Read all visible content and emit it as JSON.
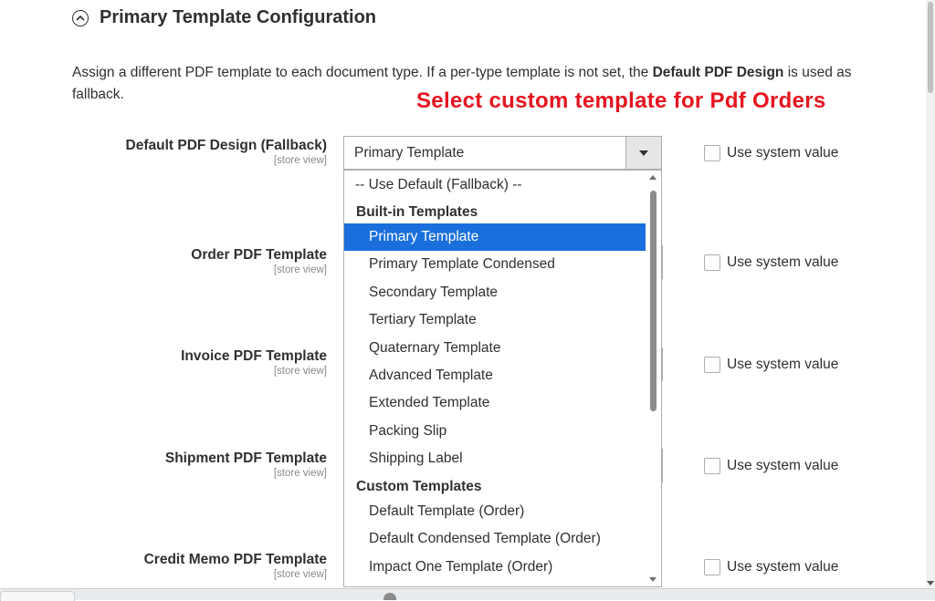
{
  "section": {
    "title": "Primary Template Configuration"
  },
  "description": {
    "part1": "Assign a different PDF template to each document type. If a per-type template is not set, the ",
    "bold": "Default PDF Design",
    "part2": " is used as fallback."
  },
  "annotation": "Select custom template for Pdf Orders",
  "fields": [
    {
      "label": "Default PDF Design (Fallback)",
      "scope": "[store view]",
      "value": "Primary Template",
      "system_value_label": "Use system value"
    },
    {
      "label": "Order PDF Template",
      "scope": "[store view]",
      "system_value_label": "Use system value"
    },
    {
      "label": "Invoice PDF Template",
      "scope": "[store view]",
      "system_value_label": "Use system value"
    },
    {
      "label": "Shipment PDF Template",
      "scope": "[store view]",
      "system_value_label": "Use system value"
    },
    {
      "label": "Credit Memo PDF Template",
      "scope": "[store view]",
      "system_value_label": "Use system value"
    }
  ],
  "dropdown": {
    "default_option": "-- Use Default (Fallback) --",
    "groups": [
      {
        "label": "Built-in Templates",
        "options": [
          "Primary Template",
          "Primary Template Condensed",
          "Secondary Template",
          "Tertiary Template",
          "Quaternary Template",
          "Advanced Template",
          "Extended Template",
          "Packing Slip",
          "Shipping Label"
        ]
      },
      {
        "label": "Custom Templates",
        "options": [
          "Default Template (Order)",
          "Default Condensed Template (Order)",
          "Impact One Template (Order)"
        ]
      }
    ],
    "selected": "Primary Template"
  },
  "colors": {
    "annotation": "#e4151f",
    "selected_option_bg": "#1a6fdc"
  }
}
